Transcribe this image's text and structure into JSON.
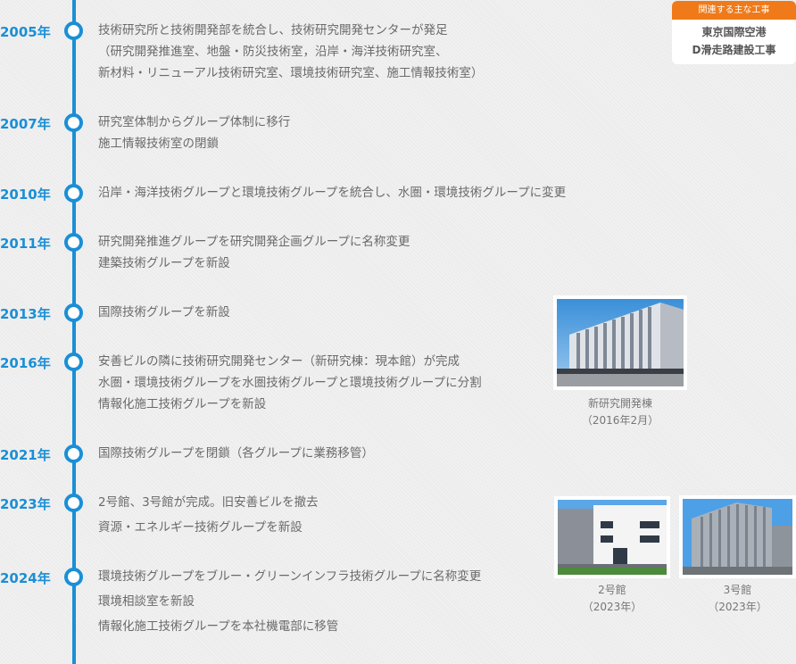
{
  "related_work": {
    "header": "関連する主な工事",
    "lines": [
      "東京国際空港",
      "D滑走路建設工事"
    ]
  },
  "timeline": [
    {
      "year": "2005年",
      "lines": [
        "技術研究所と技術開発部を統合し、技術研究開発センターが発足",
        "（研究開発推進室、地盤・防災技術室，沿岸・海洋技術研究室、",
        "新材料・リニューアル技術研究室、環境技術研究室、施工情報技術室）"
      ]
    },
    {
      "year": "2007年",
      "lines": [
        "研究室体制からグループ体制に移行",
        "施工情報技術室の閉鎖"
      ]
    },
    {
      "year": "2010年",
      "lines": [
        "沿岸・海洋技術グループと環境技術グループを統合し、水圏・環境技術グループに変更"
      ]
    },
    {
      "year": "2011年",
      "lines": [
        "研究開発推進グループを研究開発企画グループに名称変更",
        "建築技術グループを新設"
      ]
    },
    {
      "year": "2013年",
      "lines": [
        "国際技術グループを新設"
      ]
    },
    {
      "year": "2016年",
      "lines": [
        "安善ビルの隣に技術研究開発センター（新研究棟：現本館）が完成",
        "水圏・環境技術グループを水圏技術グループと環境技術グループに分割",
        "情報化施工技術グループを新設"
      ]
    },
    {
      "year": "2021年",
      "lines": [
        "国際技術グループを閉鎖（各グループに業務移管）"
      ]
    },
    {
      "year": "2023年",
      "lines": [
        "2号館、3号館が完成。旧安善ビルを撤去",
        "資源・エネルギー技術グループを新設"
      ]
    },
    {
      "year": "2024年",
      "lines": [
        "環境技術グループをブルー・グリーンインフラ技術グループに名称変更",
        "環境相談室を新設",
        "情報化施工技術グループを本社機電部に移管"
      ]
    }
  ],
  "photos": {
    "new_building": {
      "caption": [
        "新研究開発棟",
        "（2016年2月）"
      ]
    },
    "building_2": {
      "caption": [
        "2号館",
        "（2023年）"
      ]
    },
    "building_3": {
      "caption": [
        "3号館",
        "（2023年）"
      ]
    }
  },
  "colors": {
    "accent": "#1a8fd6",
    "badge": "#f07a1a"
  }
}
